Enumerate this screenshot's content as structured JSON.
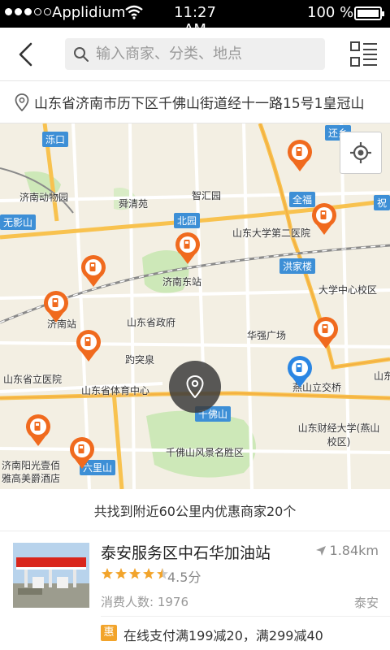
{
  "status_bar": {
    "carrier": "Applidium",
    "time": "11:27 AM",
    "battery": "100 %",
    "signal_dots_filled": 3,
    "signal_dots_total": 5
  },
  "header": {
    "search_placeholder": "输入商家、分类、地点"
  },
  "address": {
    "text": "山东省济南市历下区千佛山街道经十一路15号1皇冠山"
  },
  "map": {
    "labels": [
      "济南动物园",
      "舜清苑",
      "智汇园",
      "济南东站",
      "山东大学第二医院",
      "洪家楼",
      "大学中心校区",
      "华强广场",
      "山东省政府",
      "趵突泉",
      "济南站",
      "山东省立医院",
      "山东省体育中心",
      "千佛山风景名胜区",
      "燕山立交桥",
      "山东财经大学(燕山校区)",
      "济南阳光壹佰",
      "雅高美爵酒店",
      "山东",
      "丝"
    ],
    "road_tags": [
      "泺口",
      "全福",
      "北园",
      "千佛山",
      "燕山立交桥",
      "六里山",
      "还乡",
      "祝",
      "无影山"
    ],
    "colors": {
      "marker": "#f06a1e",
      "marker_blue": "#2b86e3",
      "road_major": "#f8c24f",
      "road_minor": "#ffffff",
      "park": "#cde8b8"
    }
  },
  "summary": "共找到附近60公里内优惠商家20个",
  "listing": {
    "name": "泰安服务区中石华加油站",
    "distance": "1.84km",
    "rating": 4.5,
    "rating_text": "4.5分",
    "consumers": "消费人数: 1976",
    "city": "泰安",
    "promo_badge": "惠",
    "promo_text": "在线支付满199减20，满299减40",
    "colors": {
      "star": "#f2a42b",
      "badge": "#f2a42b"
    }
  }
}
